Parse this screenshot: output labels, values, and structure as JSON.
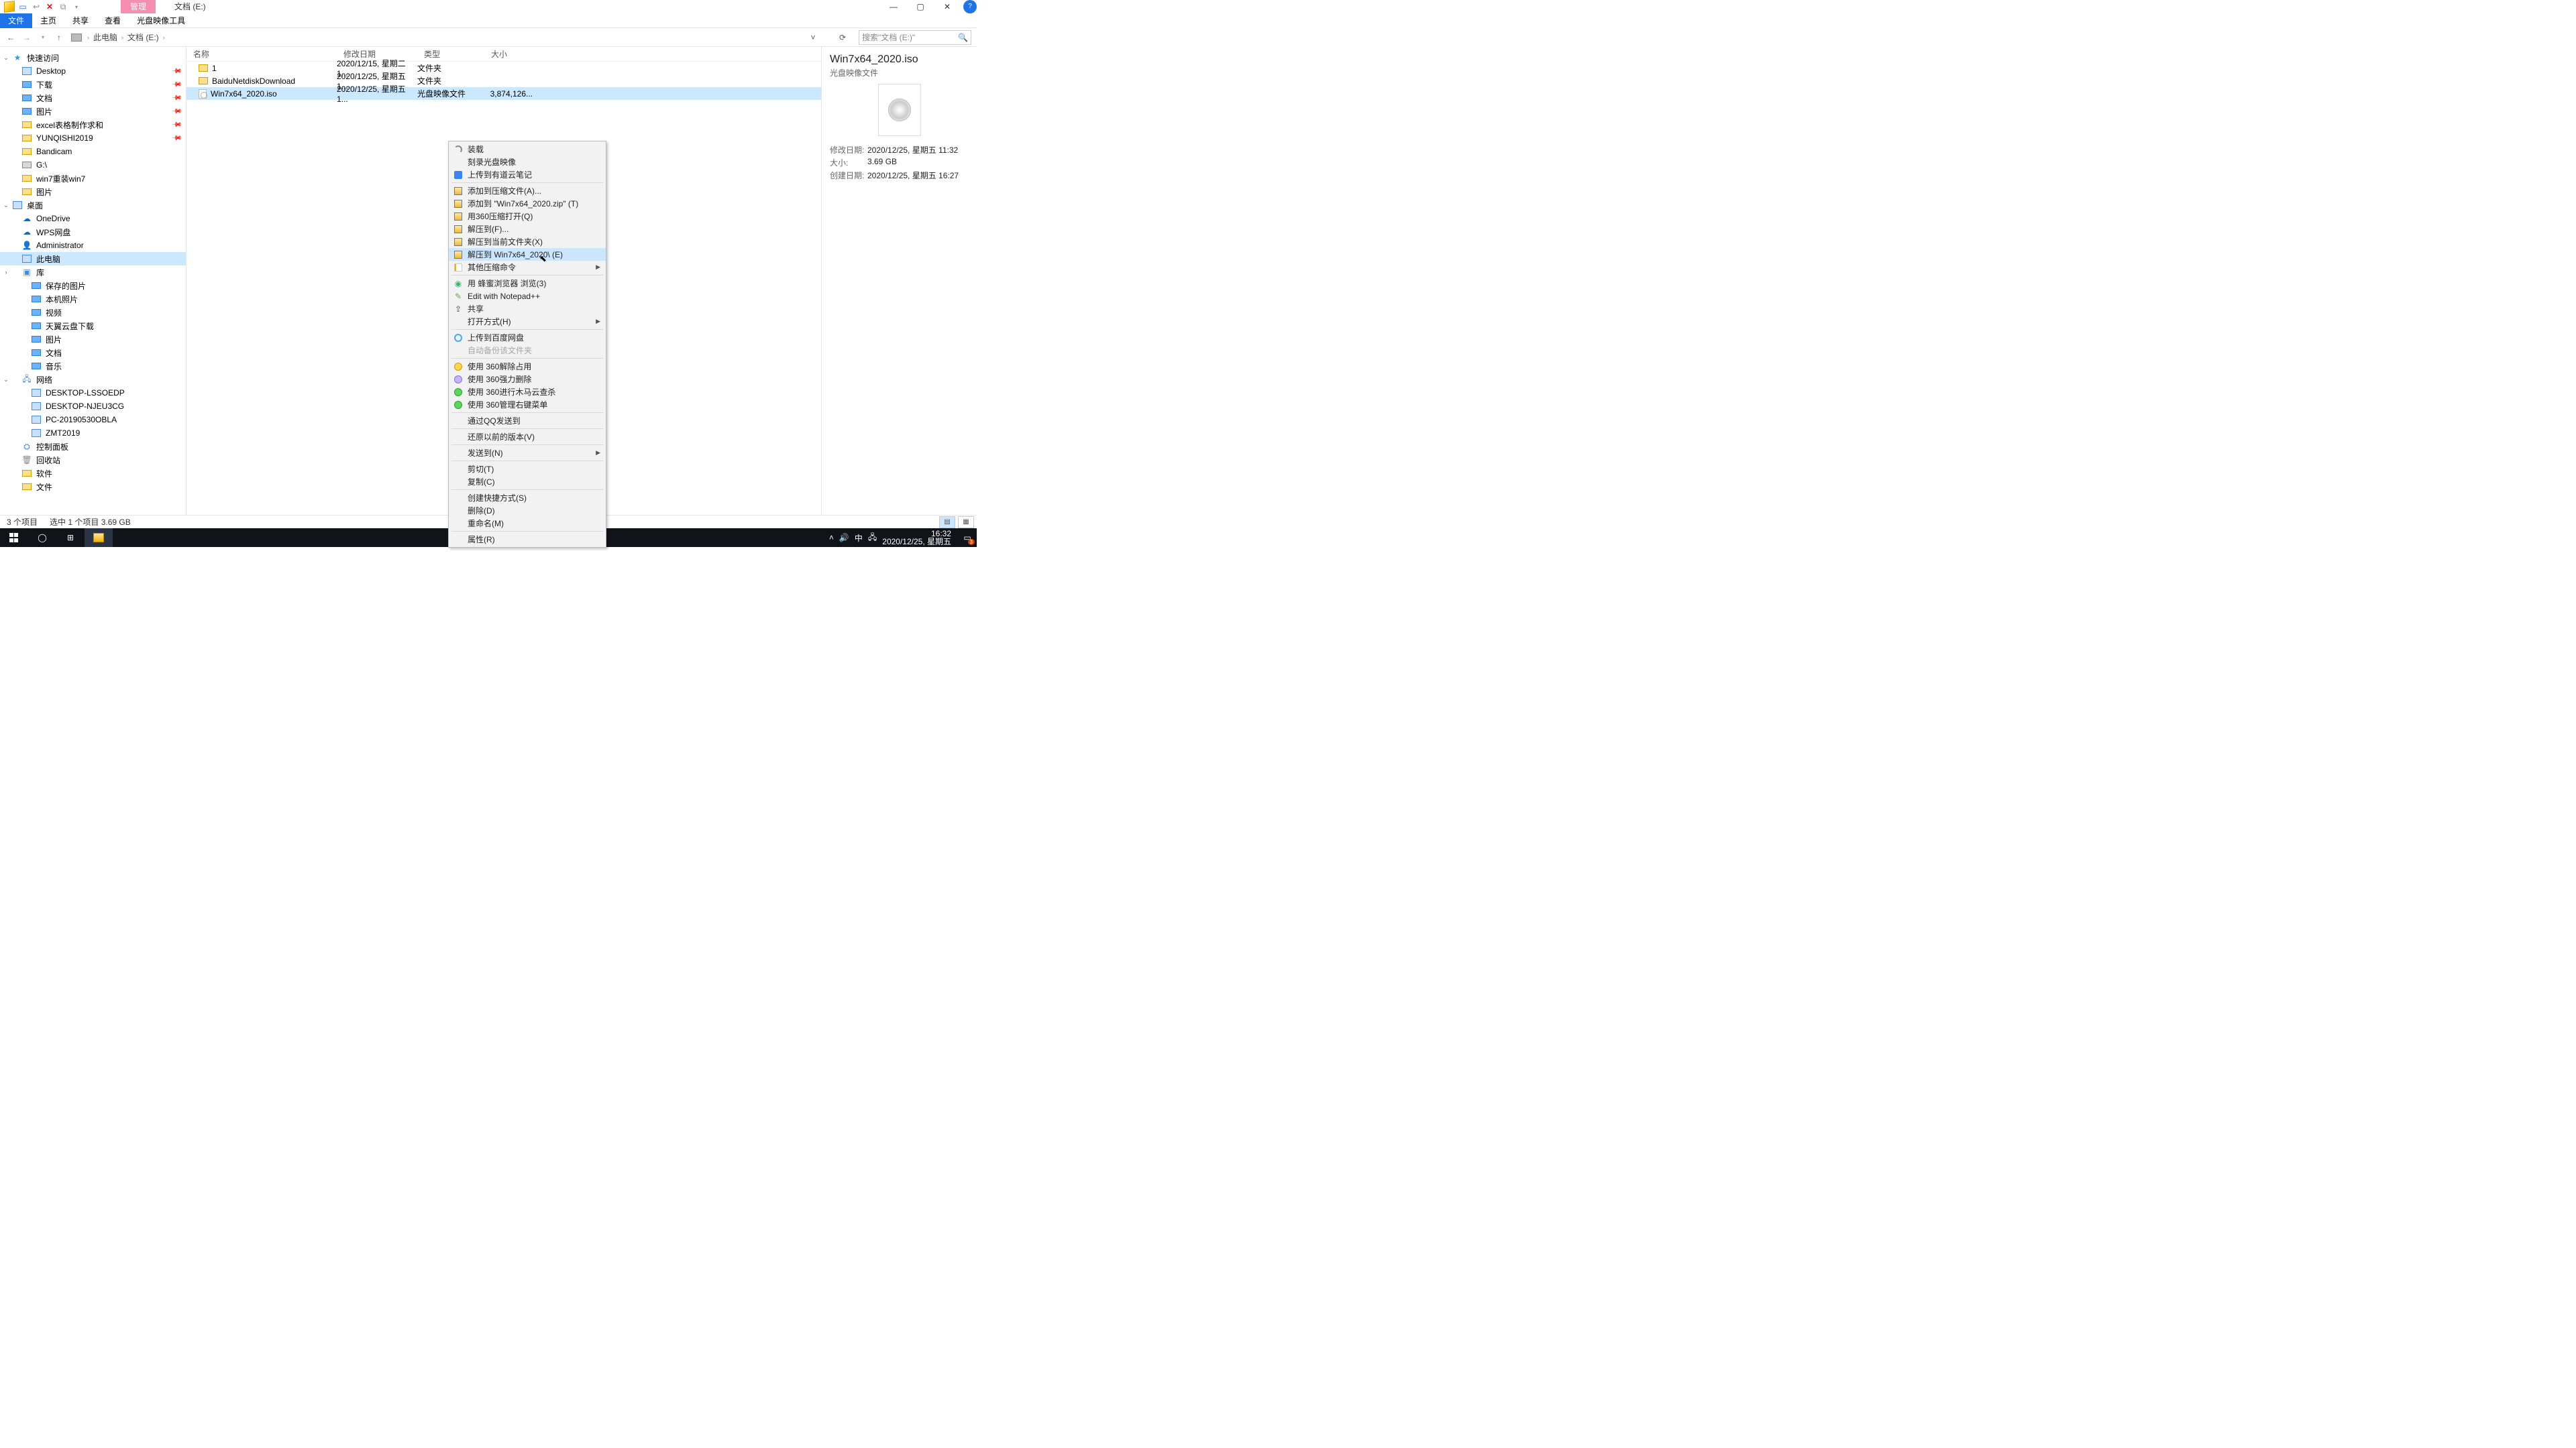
{
  "title": {
    "ribbonContext": "管理",
    "windowTitle": "文档 (E:)"
  },
  "ribbon": {
    "file": "文件",
    "tabs": [
      "主页",
      "共享",
      "查看",
      "光盘映像工具"
    ]
  },
  "nav": {
    "crumbs": [
      "此电脑",
      "文档 (E:)"
    ],
    "searchPlaceholder": "搜索\"文档 (E:)\""
  },
  "tree": [
    {
      "d": 1,
      "ico": "star",
      "label": "快速访问",
      "exp": "v"
    },
    {
      "d": 2,
      "ico": "mon",
      "label": "Desktop",
      "pin": true
    },
    {
      "d": 2,
      "ico": "foldb",
      "label": "下载",
      "pin": true
    },
    {
      "d": 2,
      "ico": "foldb",
      "label": "文档",
      "pin": true
    },
    {
      "d": 2,
      "ico": "foldb",
      "label": "图片",
      "pin": true
    },
    {
      "d": 2,
      "ico": "fold",
      "label": "excel表格制作求和",
      "pin": true
    },
    {
      "d": 2,
      "ico": "fold",
      "label": "YUNQISHI2019",
      "pin": true
    },
    {
      "d": 2,
      "ico": "fold",
      "label": "Bandicam"
    },
    {
      "d": 2,
      "ico": "drive",
      "label": "G:\\"
    },
    {
      "d": 2,
      "ico": "fold",
      "label": "win7重装win7"
    },
    {
      "d": 2,
      "ico": "fold",
      "label": "图片"
    },
    {
      "d": 1,
      "ico": "mon",
      "label": "桌面",
      "exp": "v"
    },
    {
      "d": 2,
      "ico": "od",
      "label": "OneDrive"
    },
    {
      "d": 2,
      "ico": "cloud",
      "label": "WPS网盘"
    },
    {
      "d": 2,
      "ico": "user",
      "label": "Administrator"
    },
    {
      "d": 2,
      "ico": "mon",
      "label": "此电脑",
      "sel": true
    },
    {
      "d": 2,
      "ico": "lib",
      "label": "库",
      "exp": ">"
    },
    {
      "d": 3,
      "ico": "foldb",
      "label": "保存的图片"
    },
    {
      "d": 3,
      "ico": "foldb",
      "label": "本机照片"
    },
    {
      "d": 3,
      "ico": "foldb",
      "label": "视频"
    },
    {
      "d": 3,
      "ico": "foldb",
      "label": "天翼云盘下载"
    },
    {
      "d": 3,
      "ico": "foldb",
      "label": "图片"
    },
    {
      "d": 3,
      "ico": "foldb",
      "label": "文档"
    },
    {
      "d": 3,
      "ico": "foldb",
      "label": "音乐"
    },
    {
      "d": 2,
      "ico": "net",
      "label": "网络",
      "exp": "v"
    },
    {
      "d": 3,
      "ico": "mon",
      "label": "DESKTOP-LSSOEDP"
    },
    {
      "d": 3,
      "ico": "mon",
      "label": "DESKTOP-NJEU3CG"
    },
    {
      "d": 3,
      "ico": "mon",
      "label": "PC-20190530OBLA"
    },
    {
      "d": 3,
      "ico": "mon",
      "label": "ZMT2019"
    },
    {
      "d": 2,
      "ico": "ctrl",
      "label": "控制面板"
    },
    {
      "d": 2,
      "ico": "bin",
      "label": "回收站"
    },
    {
      "d": 2,
      "ico": "fold",
      "label": "软件"
    },
    {
      "d": 2,
      "ico": "fold",
      "label": "文件"
    }
  ],
  "columns": {
    "name": "名称",
    "modified": "修改日期",
    "type": "类型",
    "size": "大小"
  },
  "rows": [
    {
      "ico": "folder",
      "name": "1",
      "mod": "2020/12/15, 星期二 1...",
      "type": "文件夹",
      "size": ""
    },
    {
      "ico": "folder",
      "name": "BaiduNetdiskDownload",
      "mod": "2020/12/25, 星期五 1...",
      "type": "文件夹",
      "size": ""
    },
    {
      "ico": "iso",
      "name": "Win7x64_2020.iso",
      "mod": "2020/12/25, 星期五 1...",
      "type": "光盘映像文件",
      "size": "3,874,126...",
      "sel": true
    }
  ],
  "context": [
    {
      "ico": "arc",
      "label": "装载"
    },
    {
      "label": "刻录光盘映像"
    },
    {
      "ico": "blue",
      "label": "上传到有道云笔记"
    },
    {
      "sep": true
    },
    {
      "ico": "box",
      "label": "添加到压缩文件(A)..."
    },
    {
      "ico": "box",
      "label": "添加到 \"Win7x64_2020.zip\" (T)"
    },
    {
      "ico": "box",
      "label": "用360压缩打开(Q)"
    },
    {
      "ico": "box",
      "label": "解压到(F)..."
    },
    {
      "ico": "box",
      "label": "解压到当前文件夹(X)"
    },
    {
      "ico": "box",
      "label": "解压到 Win7x64_2020\\ (E)",
      "hover": true
    },
    {
      "ico": "book",
      "label": "其他压缩命令",
      "sub": true
    },
    {
      "sep": true
    },
    {
      "ico": "dot",
      "label": "用 蜂蜜浏览器 浏览(3)"
    },
    {
      "ico": "npp",
      "label": "Edit with Notepad++"
    },
    {
      "ico": "share",
      "label": "共享"
    },
    {
      "label": "打开方式(H)",
      "sub": true
    },
    {
      "sep": true
    },
    {
      "ico": "pan",
      "label": "上传到百度网盘"
    },
    {
      "label": "自动备份该文件夹",
      "disabled": true
    },
    {
      "sep": true
    },
    {
      "ico": "360",
      "label": "使用 360解除占用"
    },
    {
      "ico": "360d",
      "label": "使用 360强力删除"
    },
    {
      "ico": "360g",
      "label": "使用 360进行木马云查杀"
    },
    {
      "ico": "360g",
      "label": "使用 360管理右键菜单"
    },
    {
      "sep": true
    },
    {
      "label": "通过QQ发送到"
    },
    {
      "sep": true
    },
    {
      "label": "还原以前的版本(V)"
    },
    {
      "sep": true
    },
    {
      "label": "发送到(N)",
      "sub": true
    },
    {
      "sep": true
    },
    {
      "label": "剪切(T)"
    },
    {
      "label": "复制(C)"
    },
    {
      "sep": true
    },
    {
      "label": "创建快捷方式(S)"
    },
    {
      "label": "删除(D)"
    },
    {
      "label": "重命名(M)"
    },
    {
      "sep": true
    },
    {
      "label": "属性(R)"
    }
  ],
  "details": {
    "title": "Win7x64_2020.iso",
    "subtitle": "光盘映像文件",
    "props": [
      {
        "k": "修改日期:",
        "v": "2020/12/25, 星期五 11:32"
      },
      {
        "k": "大小:",
        "v": "3.69 GB"
      },
      {
        "k": "创建日期:",
        "v": "2020/12/25, 星期五 16:27"
      }
    ]
  },
  "status": {
    "left": "3 个项目",
    "mid": "选中 1 个项目  3.69 GB"
  },
  "taskbar": {
    "time": "16:32",
    "date": "2020/12/25, 星期五",
    "ime": "中",
    "badge": "3"
  }
}
